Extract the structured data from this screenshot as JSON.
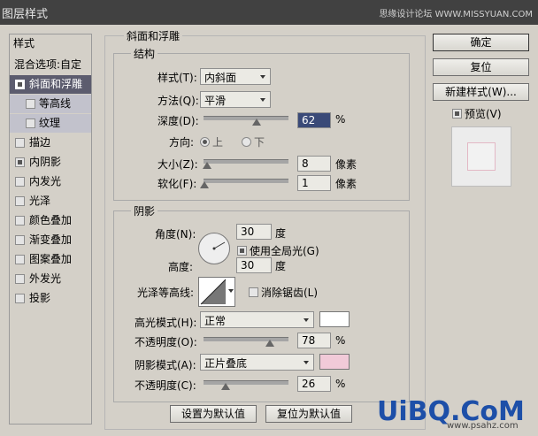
{
  "window": {
    "title": "图层样式",
    "watermark": "思缘设计论坛 WWW.MISSYUAN.COM"
  },
  "left_panel": {
    "items": [
      {
        "label": "样式",
        "checkbox": false
      },
      {
        "label": "混合选项:自定",
        "checkbox": false
      },
      {
        "label": "斜面和浮雕",
        "checkbox": true,
        "checked": true,
        "selected": true
      },
      {
        "label": "等高线",
        "checkbox": true,
        "checked": false,
        "sub": true
      },
      {
        "label": "纹理",
        "checkbox": true,
        "checked": false,
        "sub": true
      },
      {
        "label": "描边",
        "checkbox": true,
        "checked": false
      },
      {
        "label": "内阴影",
        "checkbox": true,
        "checked": true
      },
      {
        "label": "内发光",
        "checkbox": true,
        "checked": false
      },
      {
        "label": "光泽",
        "checkbox": true,
        "checked": false
      },
      {
        "label": "颜色叠加",
        "checkbox": true,
        "checked": false
      },
      {
        "label": "渐变叠加",
        "checkbox": true,
        "checked": false
      },
      {
        "label": "图案叠加",
        "checkbox": true,
        "checked": false
      },
      {
        "label": "外发光",
        "checkbox": true,
        "checked": false
      },
      {
        "label": "投影",
        "checkbox": true,
        "checked": false
      }
    ]
  },
  "bevel": {
    "title": "斜面和浮雕",
    "structure": {
      "title": "结构",
      "style_label": "样式(T):",
      "style_value": "内斜面",
      "technique_label": "方法(Q):",
      "technique_value": "平滑",
      "depth_label": "深度(D):",
      "depth_value": "62",
      "depth_unit": "%",
      "depth_slider": 0.62,
      "direction_label": "方向:",
      "dir_up": "上",
      "dir_down": "下",
      "size_label": "大小(Z):",
      "size_value": "8",
      "size_unit": "像素",
      "size_slider": 0.04,
      "soften_label": "软化(F):",
      "soften_value": "1",
      "soften_unit": "像素",
      "soften_slider": 0.01
    },
    "shading": {
      "title": "阴影",
      "angle_label": "角度(N):",
      "angle_value": "30",
      "angle_unit": "度",
      "global_light_label": "使用全局光(G)",
      "altitude_label": "高度:",
      "altitude_value": "30",
      "altitude_unit": "度",
      "gloss_label": "光泽等高线:",
      "antialias_label": "消除锯齿(L)",
      "highlight_mode_label": "高光模式(H):",
      "highlight_mode_value": "正常",
      "highlight_color": "#ffffff",
      "highlight_opacity_label": "不透明度(O):",
      "highlight_opacity_value": "78",
      "highlight_opacity_unit": "%",
      "highlight_opacity_slider": 0.78,
      "shadow_mode_label": "阴影模式(A):",
      "shadow_mode_value": "正片叠底",
      "shadow_color": "#f1cad8",
      "shadow_opacity_label": "不透明度(C):",
      "shadow_opacity_value": "26",
      "shadow_opacity_unit": "%",
      "shadow_opacity_slider": 0.26
    },
    "make_default": "设置为默认值",
    "reset_default": "复位为默认值"
  },
  "buttons": {
    "ok": "确定",
    "reset": "复位",
    "new_style": "新建样式(W)...",
    "preview_label": "预览(V)"
  },
  "watermark2": {
    "main": "UiBQ.CoM",
    "url": "www.psahz.com"
  }
}
